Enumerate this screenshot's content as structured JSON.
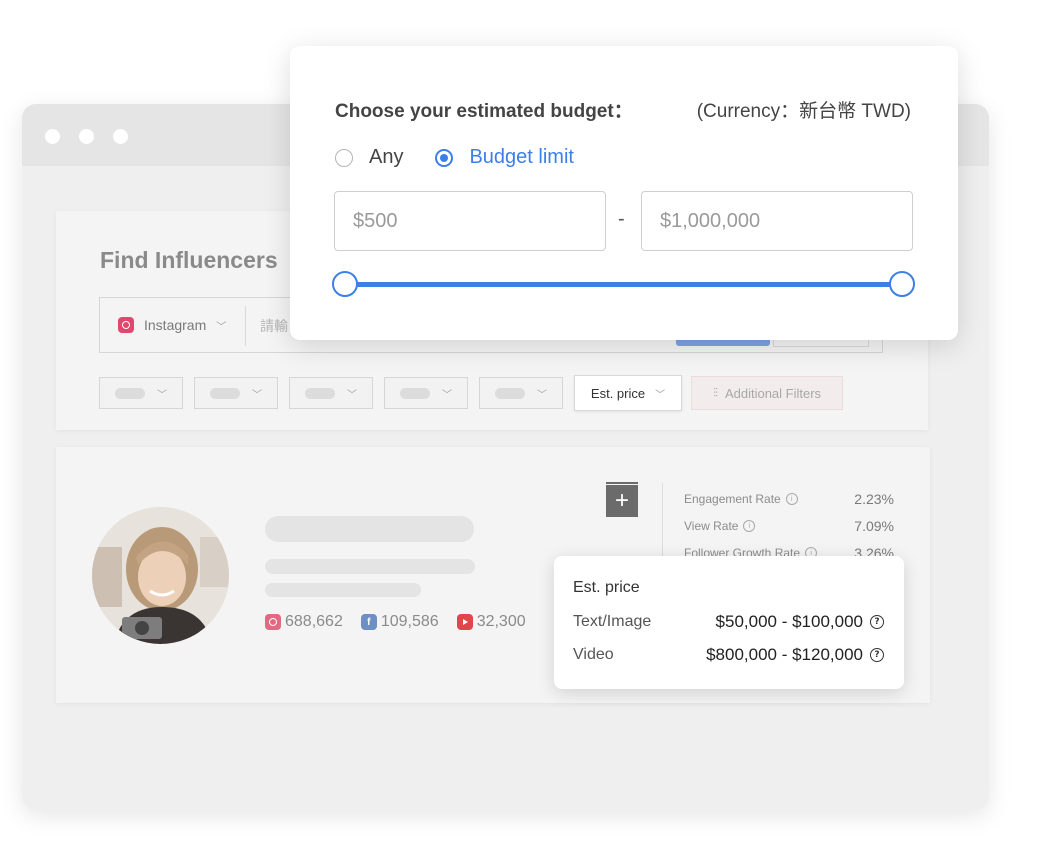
{
  "find_page": {
    "title": "Find Influencers",
    "search": {
      "platform": "Instagram",
      "placeholder": "請輸"
    },
    "filters": {
      "est_price_label": "Est. price",
      "additional_filters_label": "Additional Filters"
    }
  },
  "profile": {
    "socials": {
      "instagram": "688,662",
      "facebook": "109,586",
      "youtube": "32,300"
    },
    "metrics": [
      {
        "label": "Engagement Rate",
        "value": "2.23%"
      },
      {
        "label": "View Rate",
        "value": "7.09%"
      },
      {
        "label": "Follower Growth Rate",
        "value": "3.26%"
      }
    ]
  },
  "price_popover": {
    "title": "Est. price",
    "rows": [
      {
        "label": "Text/Image",
        "value": "$50,000 - $100,000"
      },
      {
        "label": "Video",
        "value": "$800,000 - $120,000"
      }
    ]
  },
  "budget_popover": {
    "title": "Choose your estimated budget：",
    "currency": "(Currency：新台幣 TWD)",
    "options": [
      "Any",
      "Budget limit"
    ],
    "selected_option": "Budget limit",
    "min_placeholder": "$500",
    "max_placeholder": "$1,000,000",
    "range_separator": "-",
    "slider_range_fraction": [
      0,
      1
    ]
  },
  "colors": {
    "accent": "#3d7fe8",
    "instagram": "#e0486d",
    "facebook": "#6d8fc4",
    "youtube": "#e0464c"
  },
  "icons": [
    "instagram-icon",
    "facebook-icon",
    "youtube-icon",
    "bookmark-add-icon",
    "info-icon",
    "help-icon",
    "sliders-icon",
    "chevron-down-icon"
  ]
}
